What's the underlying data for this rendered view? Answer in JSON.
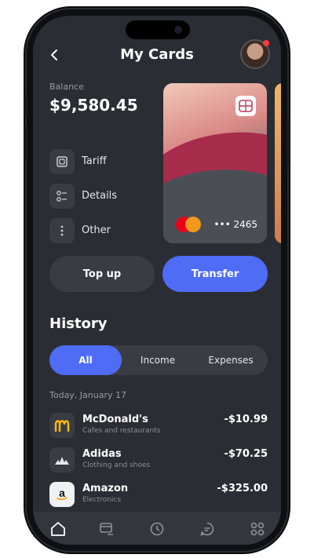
{
  "header": {
    "title": "My Cards"
  },
  "balance": {
    "label": "Balance",
    "amount": "$9,580.45"
  },
  "menu": [
    {
      "label": "Tariff",
      "icon": "tariff-icon"
    },
    {
      "label": "Details",
      "icon": "details-icon"
    },
    {
      "label": "Other",
      "icon": "more-vertical-icon"
    }
  ],
  "card": {
    "number": "••• 2465",
    "brand": "mastercard-logo"
  },
  "actions": {
    "top_up": "Top up",
    "transfer": "Transfer"
  },
  "history": {
    "title": "History",
    "tabs": [
      "All",
      "Income",
      "Expenses"
    ],
    "active_tab": "All",
    "date": "Today, January 17",
    "transactions": [
      {
        "name": "McDonald's",
        "category": "Cafes and restaurants",
        "amount": "-$10.99",
        "icon": "mcdonalds-logo"
      },
      {
        "name": "Adidas",
        "category": "Clothing and shoes",
        "amount": "-$70.25",
        "icon": "adidas-logo"
      },
      {
        "name": "Amazon",
        "category": "Electronics",
        "amount": "-$325.00",
        "icon": "amazon-logo"
      }
    ]
  },
  "nav": [
    "home-icon",
    "cards-icon",
    "history-icon",
    "chat-icon",
    "grid-icon"
  ],
  "colors": {
    "accent": "#4f6cf7",
    "background": "#2b2d34",
    "surface": "#3a3c44"
  }
}
